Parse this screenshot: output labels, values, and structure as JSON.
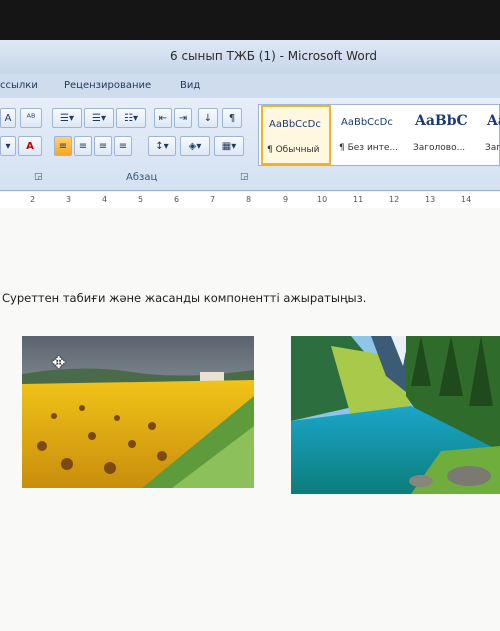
{
  "window": {
    "title": "6 сынып ТЖБ (1) - Microsoft Word"
  },
  "menu": {
    "items": [
      {
        "label": "ссылки"
      },
      {
        "label": "Рецензирование"
      },
      {
        "label": "Вид"
      }
    ]
  },
  "ribbon": {
    "paragraph_group_label": "Абзац",
    "styles": [
      {
        "sample": "AaBbCcDc",
        "name": "¶ Обычный",
        "selected": true
      },
      {
        "sample": "AaBbCcDc",
        "name": "¶ Без инте...",
        "selected": false
      },
      {
        "sample": "AaBbC",
        "name": "Заголово...",
        "selected": false
      },
      {
        "sample": "Aa",
        "name": "Заг",
        "selected": false
      }
    ],
    "font_color_label": "A",
    "grow_font_label": "A"
  },
  "ruler": {
    "numbers": [
      "2",
      "3",
      "4",
      "5",
      "6",
      "7",
      "8",
      "9",
      "10",
      "11",
      "12",
      "13",
      "14"
    ]
  },
  "document": {
    "question": "Суреттен табиғи және жасанды компоненттi ажыратыңыз.",
    "images": [
      {
        "name": "sunflower-field-image"
      },
      {
        "name": "mountain-lake-image"
      }
    ]
  },
  "colors": {
    "ribbon": "#d4e1f2",
    "selected_style": "#f0b429",
    "page": "#f9f9f8"
  }
}
